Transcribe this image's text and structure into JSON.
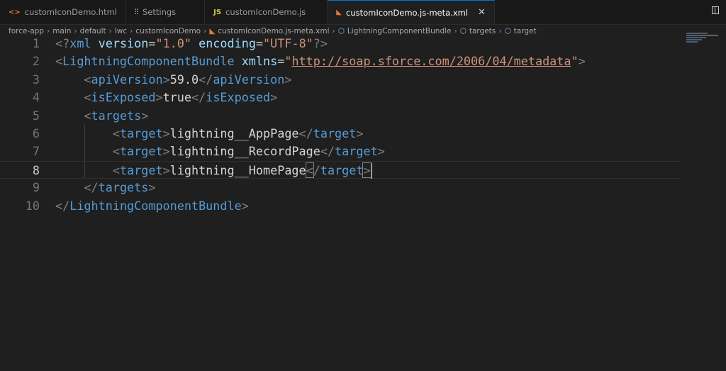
{
  "tabs": [
    {
      "label": "customIconDemo.html",
      "icon": "html-icon"
    },
    {
      "label": "Settings",
      "icon": "settings-icon"
    },
    {
      "label": "customIconDemo.js",
      "icon": "js-icon"
    },
    {
      "label": "customIconDemo.js-meta.xml",
      "icon": "rss-xml-icon",
      "active": true
    }
  ],
  "breadcrumb": [
    "force-app",
    "main",
    "default",
    "lwc",
    "customIconDemo",
    "customIconDemo.js-meta.xml",
    "LightningComponentBundle",
    "targets",
    "target"
  ],
  "code": {
    "l1": {
      "a": "<?",
      "b": "xml",
      "c": " version",
      "d": "=",
      "e": "\"1.0\"",
      "f": " encoding",
      "g": "=",
      "h": "\"UTF-8\"",
      "i": "?>"
    },
    "l2": {
      "tag": "LightningComponentBundle",
      "attr": "xmlns",
      "val_q": "\"",
      "url": "http://soap.sforce.com/2006/04/metadata"
    },
    "l3": {
      "tag": "apiVersion",
      "text": "59.0"
    },
    "l4": {
      "tag": "isExposed",
      "text": "true"
    },
    "l5": {
      "tag": "targets"
    },
    "target_tag": "target",
    "l6": "lightning__AppPage",
    "l7": "lightning__RecordPage",
    "l8": "lightning__HomePage",
    "line_numbers": [
      "1",
      "2",
      "3",
      "4",
      "5",
      "6",
      "7",
      "8",
      "9",
      "10"
    ]
  }
}
